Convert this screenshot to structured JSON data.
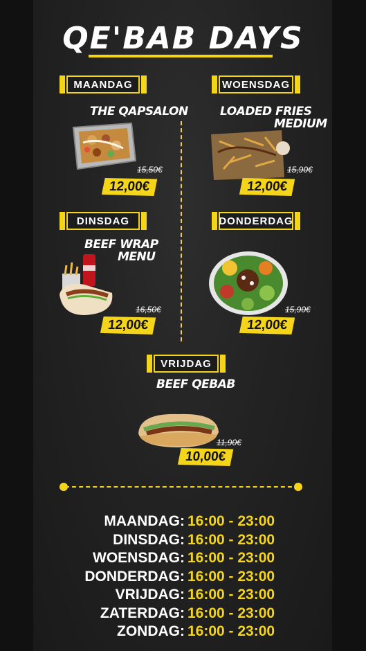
{
  "title": "QE'BAB DAYS",
  "menu": [
    {
      "day": "MAANDAG",
      "name": "THE QAPSALON",
      "old_price": "15,50€",
      "price": "12,00€"
    },
    {
      "day": "WOENSDAG",
      "name": "LOADED FRIES MEDIUM",
      "name_line1": "LOADED FRIES",
      "name_line2": "MEDIUM",
      "old_price": "15,90€",
      "price": "12,00€"
    },
    {
      "day": "DINSDAG",
      "name_line1": "BEEF WRAP",
      "name_line2": "MENU",
      "old_price": "16,50€",
      "price": "12,00€"
    },
    {
      "day": "DONDERDAG",
      "old_price": "15,90€",
      "price": "12,00€"
    },
    {
      "day": "VRIJDAG",
      "name": "BEEF QEBAB",
      "old_price": "11,90€",
      "price": "10,00€"
    }
  ],
  "hours": [
    {
      "day": "MAANDAG:",
      "time": "16:00 - 23:00"
    },
    {
      "day": "DINSDAG:",
      "time": "16:00 - 23:00"
    },
    {
      "day": "WOENSDAG:",
      "time": "16:00 - 23:00"
    },
    {
      "day": "DONDERDAG:",
      "time": "16:00 - 23:00"
    },
    {
      "day": "VRIJDAG:",
      "time": "16:00 - 23:00"
    },
    {
      "day": "ZATERDAG:",
      "time": "16:00 - 23:00"
    },
    {
      "day": "ZONDAG:",
      "time": "16:00 - 23:00"
    }
  ],
  "colors": {
    "accent": "#f5d51a",
    "background": "#232323"
  }
}
